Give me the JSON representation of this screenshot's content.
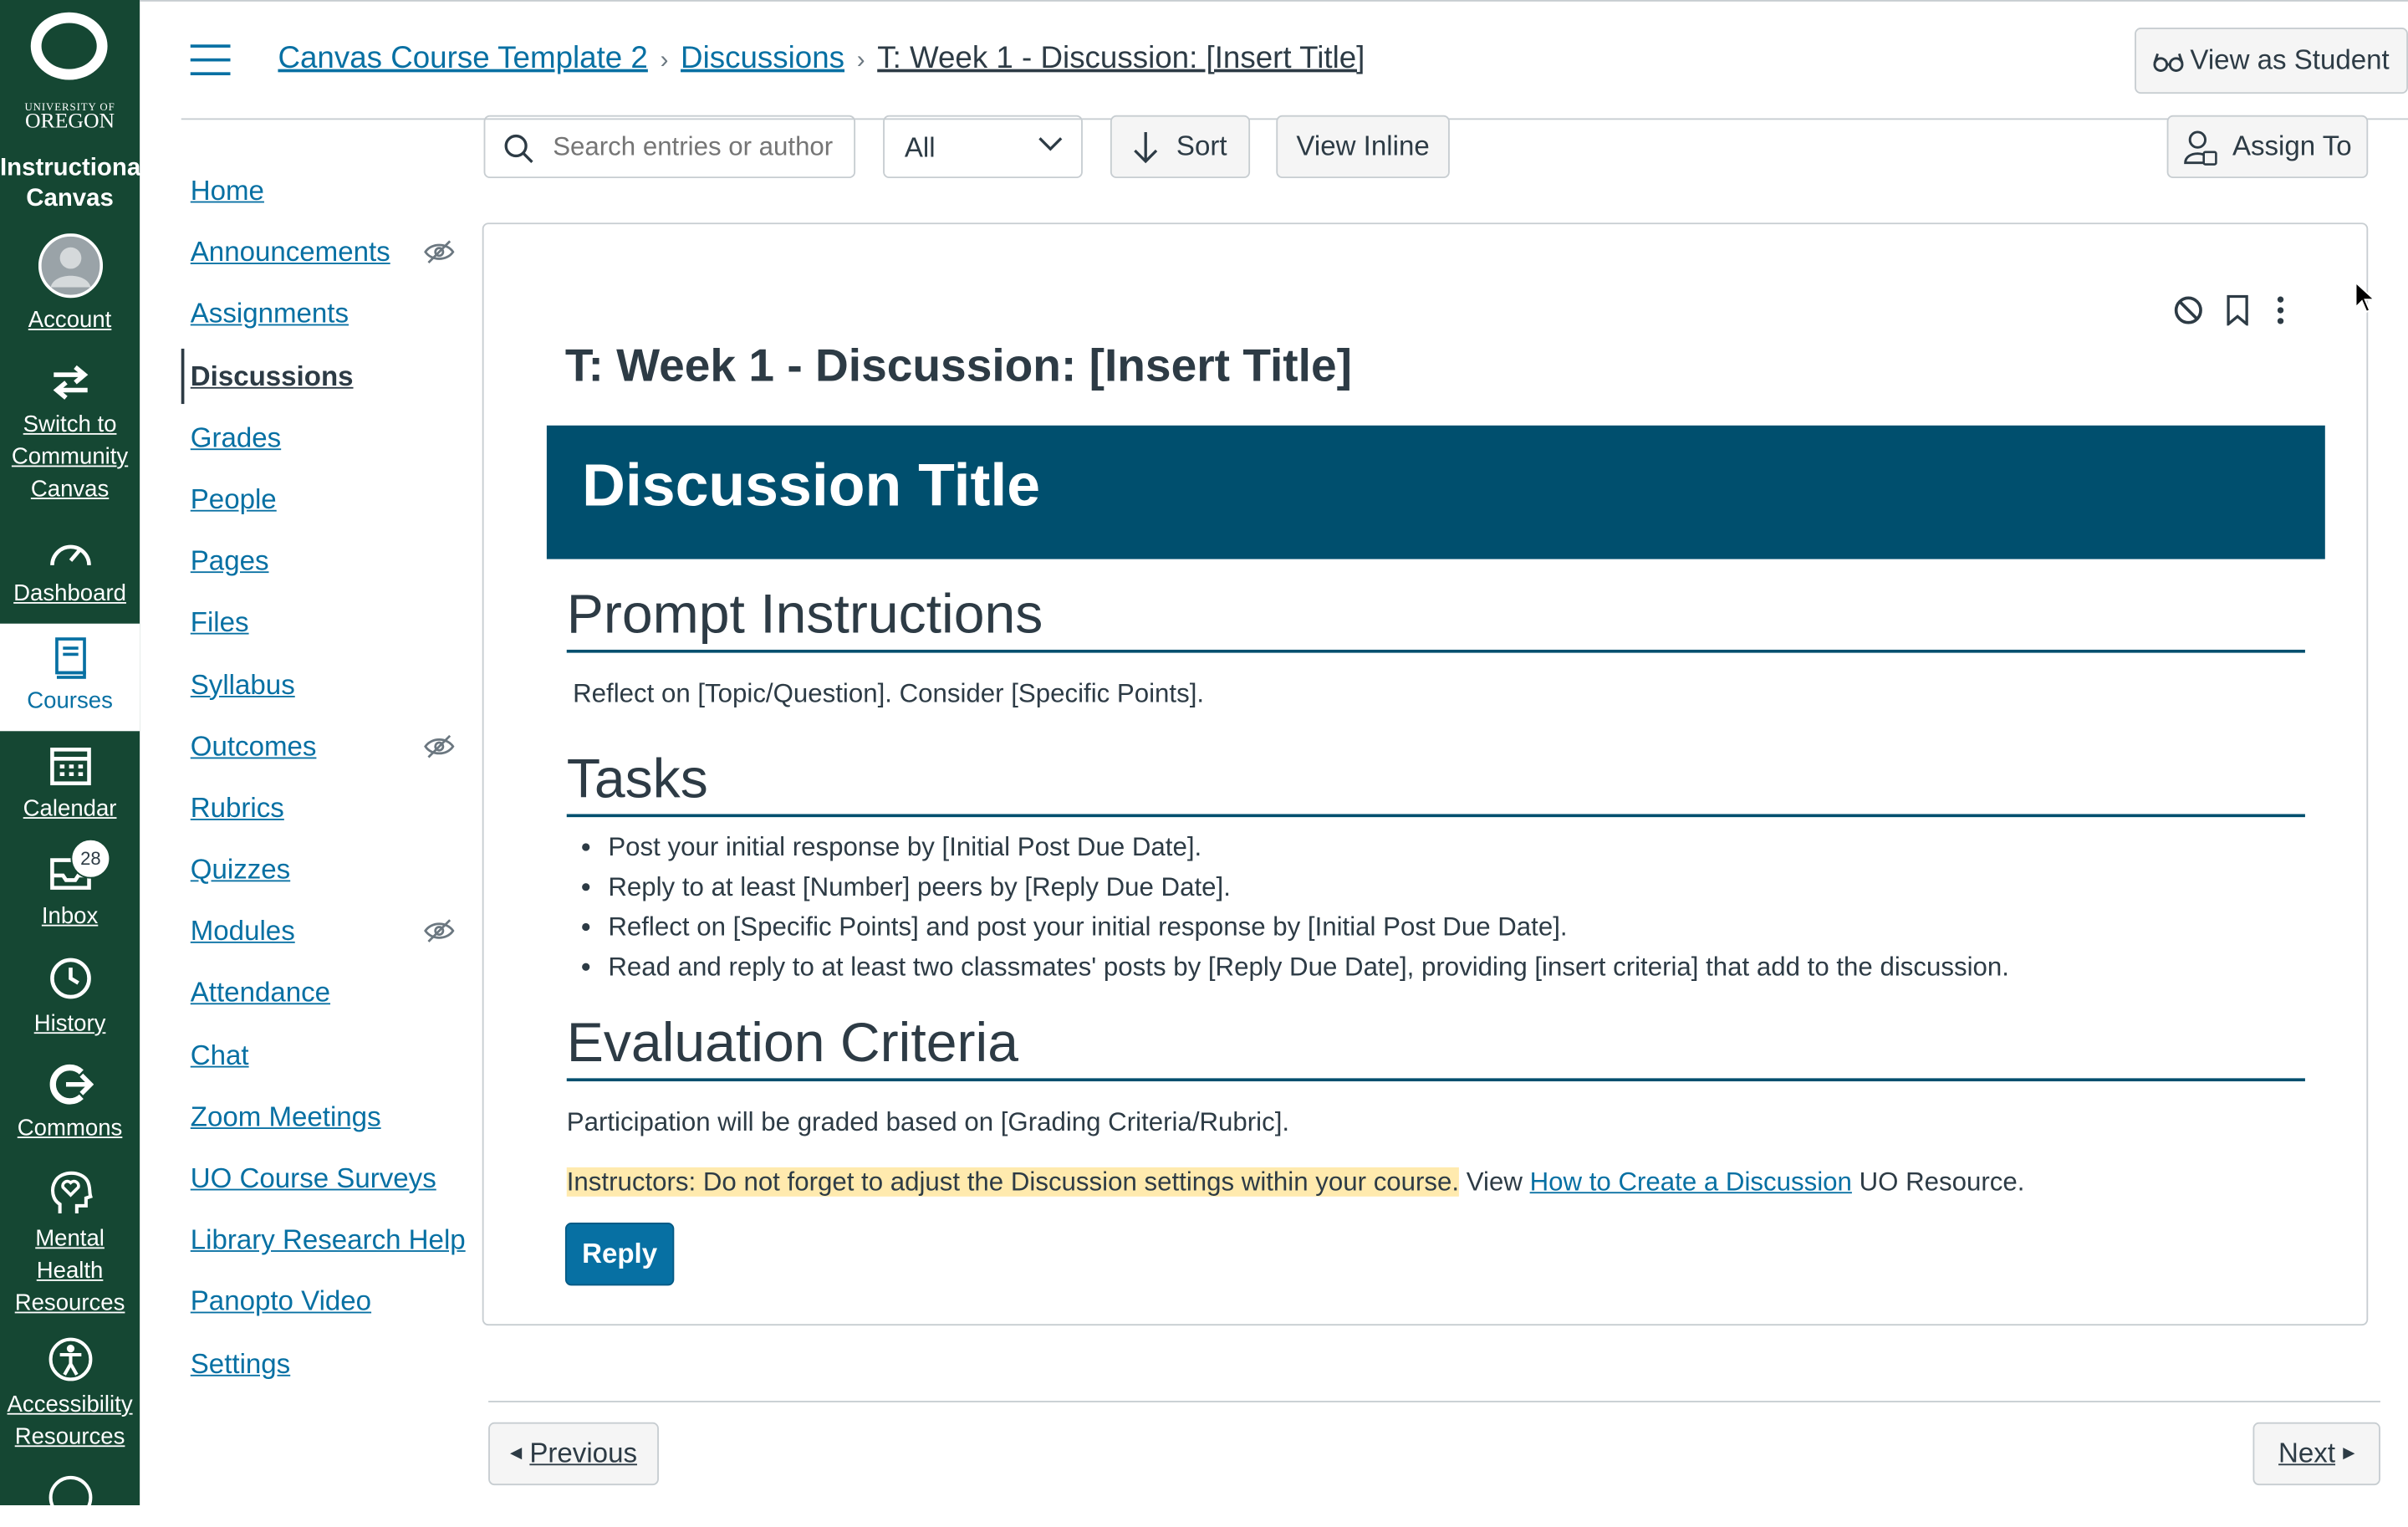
{
  "global_nav": {
    "logo": {
      "university_of": "UNIVERSITY OF",
      "oregon": "OREGON"
    },
    "brand": "Instructional Canvas",
    "items": [
      {
        "label": "Account",
        "icon": "avatar-icon"
      },
      {
        "label": "Switch to Community Canvas",
        "icon": "switch-arrows-icon"
      },
      {
        "label": "Dashboard",
        "icon": "dashboard-gauge-icon"
      },
      {
        "label": "Courses",
        "icon": "book-icon",
        "active": true
      },
      {
        "label": "Calendar",
        "icon": "calendar-icon"
      },
      {
        "label": "Inbox",
        "icon": "inbox-icon",
        "badge": "28"
      },
      {
        "label": "History",
        "icon": "clock-icon"
      },
      {
        "label": "Commons",
        "icon": "commons-icon"
      },
      {
        "label": "Mental Health Resources",
        "icon": "head-heart-icon"
      },
      {
        "label": "Accessibility Resources",
        "icon": "accessibility-icon"
      }
    ]
  },
  "header": {
    "breadcrumbs": [
      "Canvas Course Template 2",
      "Discussions",
      "T: Week 1 - Discussion: [Insert Title]"
    ],
    "view_as_student": "View as Student"
  },
  "course_nav": [
    {
      "label": "Home"
    },
    {
      "label": "Announcements",
      "hidden": true
    },
    {
      "label": "Assignments"
    },
    {
      "label": "Discussions",
      "active": true
    },
    {
      "label": "Grades"
    },
    {
      "label": "People"
    },
    {
      "label": "Pages"
    },
    {
      "label": "Files"
    },
    {
      "label": "Syllabus"
    },
    {
      "label": "Outcomes",
      "hidden": true
    },
    {
      "label": "Rubrics"
    },
    {
      "label": "Quizzes"
    },
    {
      "label": "Modules",
      "hidden": true
    },
    {
      "label": "Attendance"
    },
    {
      "label": "Chat"
    },
    {
      "label": "Zoom Meetings"
    },
    {
      "label": "UO Course Surveys"
    },
    {
      "label": "Library Research Help"
    },
    {
      "label": "Panopto Video"
    },
    {
      "label": "Settings"
    }
  ],
  "toolbar": {
    "search_placeholder": "Search entries or author",
    "filter_value": "All",
    "sort": "Sort",
    "view_inline": "View Inline",
    "assign_to": "Assign To"
  },
  "post": {
    "title": "T: Week 1 - Discussion: [Insert Title]",
    "banner": "Discussion Title",
    "prompt_heading": "Prompt Instructions",
    "prompt_text": "Reflect on [Topic/Question]. Consider [Specific Points].",
    "tasks_heading": "Tasks",
    "tasks": [
      "Post your initial response by [Initial Post Due Date].",
      "Reply to at least [Number] peers by [Reply Due Date].",
      "Reflect on [Specific Points] and post your initial response by [Initial Post Due Date].",
      "Read and reply to at least two classmates' posts by [Reply Due Date], providing [insert criteria] that add to the discussion."
    ],
    "eval_heading": "Evaluation Criteria",
    "eval_text": "Participation will be graded based on [Grading Criteria/Rubric].",
    "note_highlight": "Instructors: Do not forget to adjust the Discussion settings within your course.",
    "note_view": "View",
    "note_link": "How to Create a Discussion",
    "note_suffix": "UO Resource.",
    "reply": "Reply"
  },
  "footer": {
    "previous": "Previous",
    "next": "Next"
  },
  "colors": {
    "nav_green": "#154733",
    "banner_blue": "#004f6e",
    "link": "#0770a3",
    "highlight": "#ffeaae"
  }
}
